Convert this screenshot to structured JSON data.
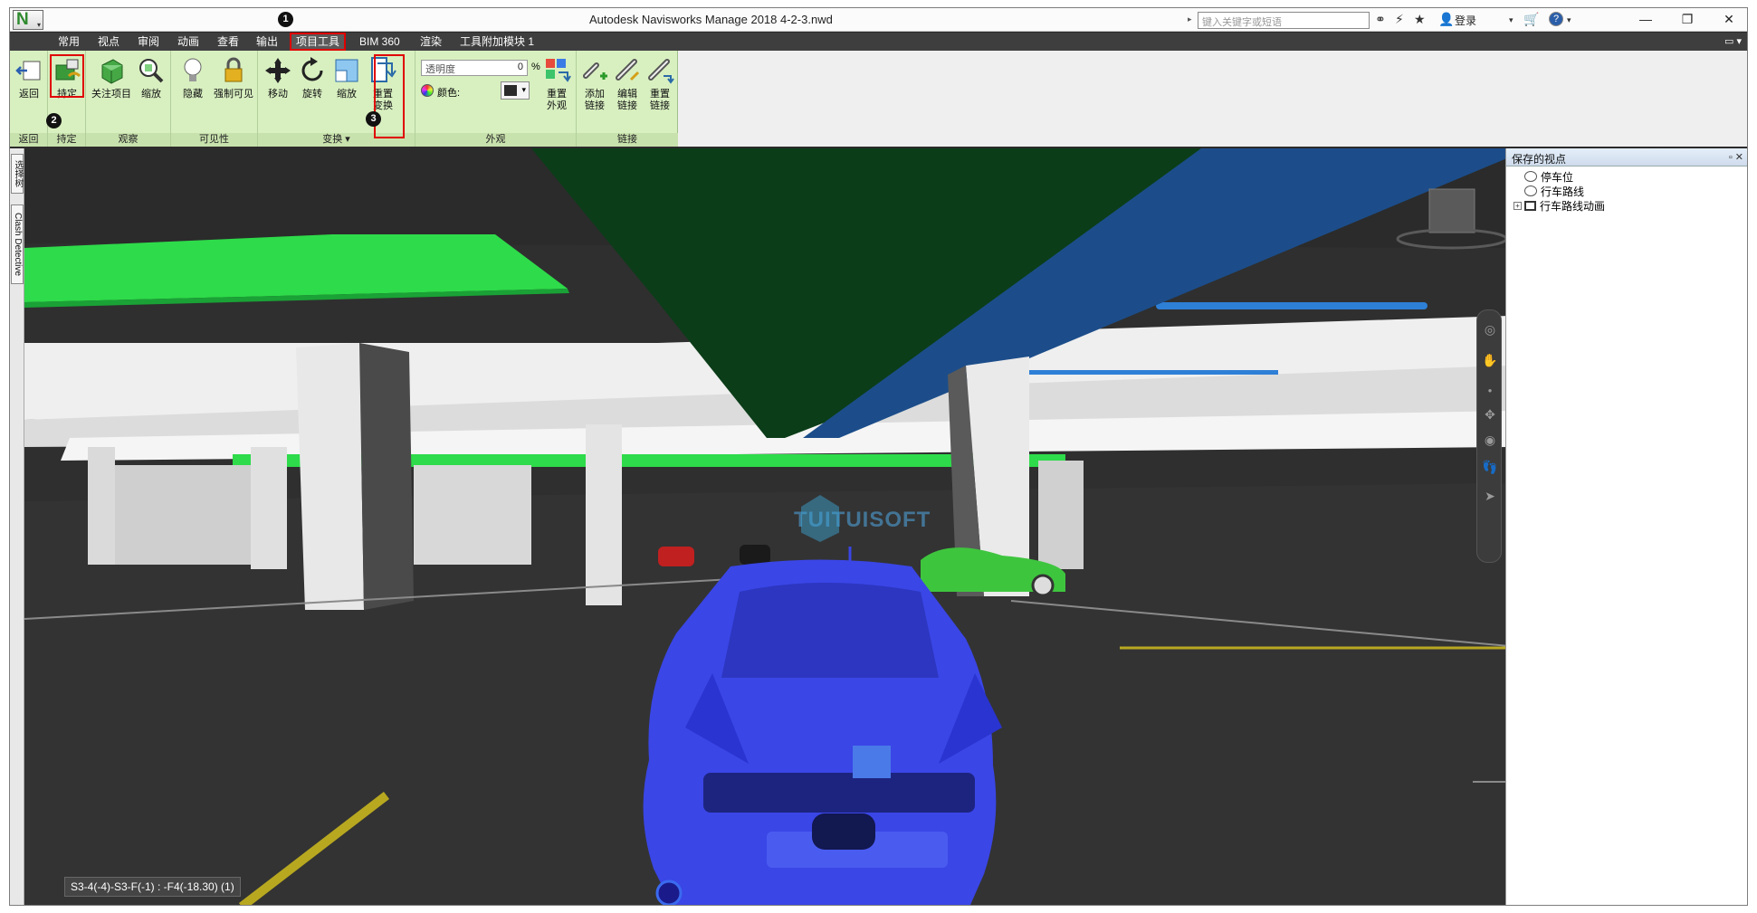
{
  "titlebar": {
    "logo": "N",
    "title": "Autodesk Navisworks Manage 2018    4-2-3.nwd",
    "search_placeholder": "键入关键字或短语",
    "signin": "登录",
    "icons": [
      "binoculars-icon",
      "satellite-icon",
      "star-icon",
      "user-icon",
      "cart-icon",
      "help-icon"
    ]
  },
  "window_controls": {
    "minimize": "—",
    "restore": "❐",
    "close": "✕"
  },
  "menu": {
    "items": [
      "常用",
      "视点",
      "审阅",
      "动画",
      "查看",
      "输出",
      "项目工具",
      "BIM 360",
      "渲染",
      "工具附加模块 1"
    ],
    "active_index": 6,
    "right": "▭ ▾"
  },
  "ribbon": {
    "groups": [
      {
        "title": "返回",
        "tools": [
          {
            "label": "返回",
            "icon": "return-icon"
          }
        ]
      },
      {
        "title": "持定",
        "tools": [
          {
            "label": "持定",
            "icon": "hold-icon"
          }
        ]
      },
      {
        "title": "观察",
        "tools": [
          {
            "label": "关注项目",
            "icon": "focus-item-icon"
          },
          {
            "label": "缩放",
            "icon": "zoom-icon"
          }
        ]
      },
      {
        "title": "可见性",
        "tools": [
          {
            "label": "隐藏",
            "icon": "hide-bulb-icon"
          },
          {
            "label": "强制可见",
            "icon": "lock-icon"
          }
        ]
      },
      {
        "title": "变换",
        "tools": [
          {
            "label": "移动",
            "icon": "move-icon"
          },
          {
            "label": "旋转",
            "icon": "rotate-icon"
          },
          {
            "label": "缩放",
            "icon": "scale-icon"
          },
          {
            "label": "重置\n变换",
            "icon": "reset-transform-icon"
          }
        ]
      },
      {
        "title": "外观",
        "transparency_label": "透明度",
        "transparency_value": "0",
        "percent": "%",
        "color_label": "颜色:",
        "reset_label": "重置\n外观"
      },
      {
        "title": "链接",
        "tools": [
          {
            "label": "添加\n链接",
            "icon": "add-link-icon"
          },
          {
            "label": "编辑\n链接",
            "icon": "edit-link-icon"
          },
          {
            "label": "重置\n链接",
            "icon": "reset-link-icon"
          }
        ]
      }
    ]
  },
  "annotations": [
    "1",
    "2",
    "3"
  ],
  "side_tabs": [
    "选择树",
    "Clash Detective"
  ],
  "panel": {
    "title": "保存的视点",
    "controls": "▫ ✕",
    "items": [
      {
        "label": "停车位",
        "type": "viewpoint"
      },
      {
        "label": "行车路线",
        "type": "viewpoint"
      },
      {
        "label": "行车路线动画",
        "type": "animation",
        "expand": "+"
      }
    ]
  },
  "viewport": {
    "status": "S3-4(-4)-S3-F(-1) : -F4(-18.30) (1)",
    "watermark": "TUITUISOFT"
  },
  "colors": {
    "ribbon_bg": "#d8f0c0",
    "menu_bg": "#3e3e3e",
    "highlight": "#e00000",
    "car_blue": "#3a46e6",
    "ceiling": "#0b3d18",
    "pipe_green": "#2ee04a"
  }
}
